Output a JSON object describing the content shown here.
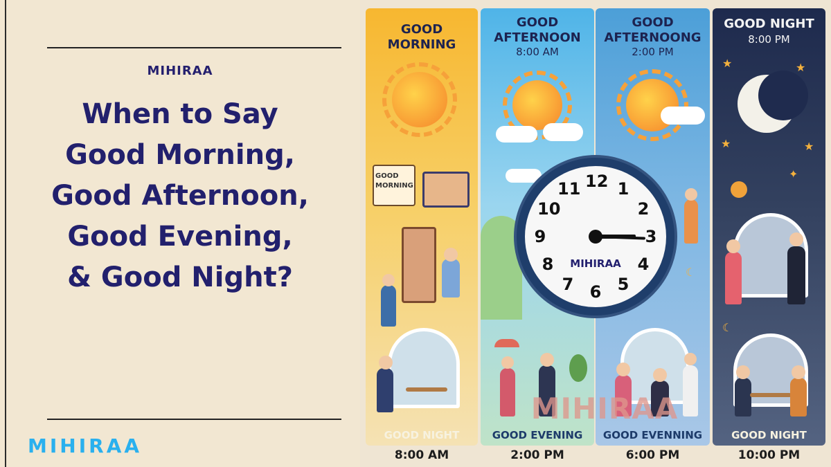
{
  "brand_small": "MIHIRAA",
  "headline": {
    "lines": [
      "When to Say",
      "Good Morning,",
      "Good Afternoon,",
      "Good Evening,",
      "& Good Night?"
    ]
  },
  "logo_text": "MIHIRAA",
  "panels": [
    {
      "title_top": "GOOD",
      "title_bottom": "MORNING",
      "time": "",
      "footer": "GOOD NIGHT",
      "sign": "GOOD MORNING"
    },
    {
      "title_top": "GOOD",
      "title_bottom": "AFTERNOON",
      "time": "8:00 AM",
      "footer": "GOOD EVENING"
    },
    {
      "title_top": "GOOD",
      "title_bottom": "AFTERNOONG",
      "time": "2:00 PM",
      "footer": "GOOD EVENNING"
    },
    {
      "title_top": "GOOD NIGHT",
      "title_bottom": "",
      "time": "8:00 PM",
      "footer": "GOOD NIGHT"
    }
  ],
  "clock": {
    "numbers": [
      "12",
      "1",
      "2",
      "3",
      "4",
      "5",
      "6",
      "7",
      "8",
      "9",
      "10",
      "11"
    ],
    "brand": "MIHIRAA"
  },
  "watermark": "MIHIRAA",
  "bottom_times": [
    "8:00 AM",
    "2:00 PM",
    "6:00 PM",
    "10:00 PM"
  ],
  "colors": {
    "navy_text": "#22206d",
    "logo_blue": "#2ab0ee",
    "background": "#f2e7d2",
    "clock_ring": "#1f3e6b"
  },
  "icons": [
    "sun-icon",
    "cloud-icon",
    "moon-icon",
    "star-icon"
  ]
}
